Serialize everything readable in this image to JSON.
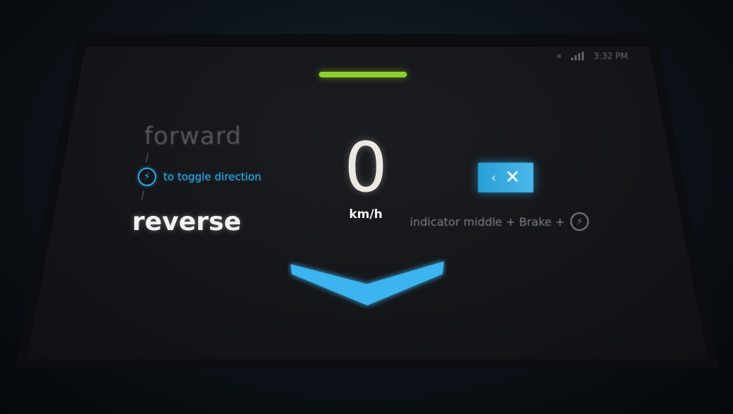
{
  "status": {
    "time": "3:32 PM"
  },
  "direction": {
    "forward_label": "forward",
    "toggle_hint": "to toggle direction",
    "reverse_label": "reverse"
  },
  "speed": {
    "value": "0",
    "unit": "km/h"
  },
  "cancel_hint": {
    "text": "indicator middle + Brake +"
  },
  "icons": {
    "toggle_icon": "lightning-circle-icon",
    "hint_icon": "lightning-circle-icon",
    "cancel_icon": "close-icon",
    "down_indicator": "chevron-down-icon",
    "signal": "signal-icon"
  },
  "colors": {
    "accent_blue": "#2fa9e6",
    "active_green": "#8ccf2c",
    "text_primary": "#f2f2f2",
    "text_muted": "#55585d"
  }
}
